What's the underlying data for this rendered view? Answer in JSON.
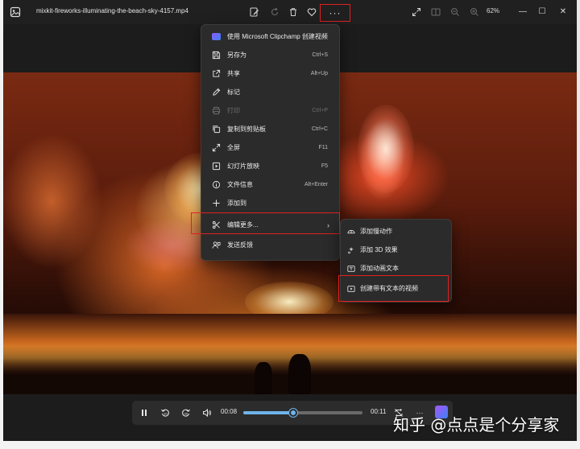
{
  "window": {
    "file_name": "mixkit-fireworks-illuminating-the-beach-sky-4157.mp4",
    "zoom": "62%",
    "toolbar": [
      {
        "name": "edit-image-icon"
      },
      {
        "name": "rotate-icon"
      },
      {
        "name": "delete-icon"
      },
      {
        "name": "favorite-heart-icon"
      }
    ],
    "more_label": "···",
    "window_controls": {
      "minimize": "—",
      "maximize": "☐",
      "close": "✕"
    }
  },
  "menu": {
    "items": [
      {
        "label": "使用 Microsoft Clipchamp 创建视频",
        "shortcut": "",
        "icon": "clipchamp-icon",
        "disabled": false
      },
      {
        "label": "另存为",
        "shortcut": "Ctrl+S",
        "icon": "save-icon",
        "disabled": false
      },
      {
        "label": "共享",
        "shortcut": "Alt+Up",
        "icon": "share-icon",
        "disabled": false
      },
      {
        "label": "标记",
        "shortcut": "",
        "icon": "markup-pen-icon",
        "disabled": false
      },
      {
        "label": "打印",
        "shortcut": "Ctrl+P",
        "icon": "print-icon",
        "disabled": true
      },
      {
        "label": "复制到剪贴板",
        "shortcut": "Ctrl+C",
        "icon": "copy-icon",
        "disabled": false
      },
      {
        "label": "全屏",
        "shortcut": "F11",
        "icon": "fullscreen-icon",
        "disabled": false
      },
      {
        "label": "幻灯片放映",
        "shortcut": "F5",
        "icon": "slideshow-icon",
        "disabled": false
      },
      {
        "label": "文件信息",
        "shortcut": "Alt+Enter",
        "icon": "info-icon",
        "disabled": false
      },
      {
        "label": "添加到",
        "shortcut": "",
        "icon": "plus-icon",
        "disabled": false
      },
      {
        "label": "编辑更多...",
        "shortcut": "",
        "icon": "edit-more-icon",
        "disabled": false
      },
      {
        "label": "发送反馈",
        "shortcut": "",
        "icon": "feedback-icon",
        "disabled": false
      }
    ]
  },
  "submenu": {
    "items": [
      {
        "label": "添加慢动作",
        "icon": "slow-motion-icon"
      },
      {
        "label": "添加 3D 效果",
        "icon": "3d-effect-icon"
      },
      {
        "label": "添加动画文本",
        "icon": "animated-text-icon"
      },
      {
        "label": "创建带有文本的视频",
        "icon": "text-video-icon"
      }
    ]
  },
  "player": {
    "current_time": "00:08",
    "duration": "00:11",
    "progress": 0.42
  },
  "watermark": "知乎 @点点是个分享家"
}
